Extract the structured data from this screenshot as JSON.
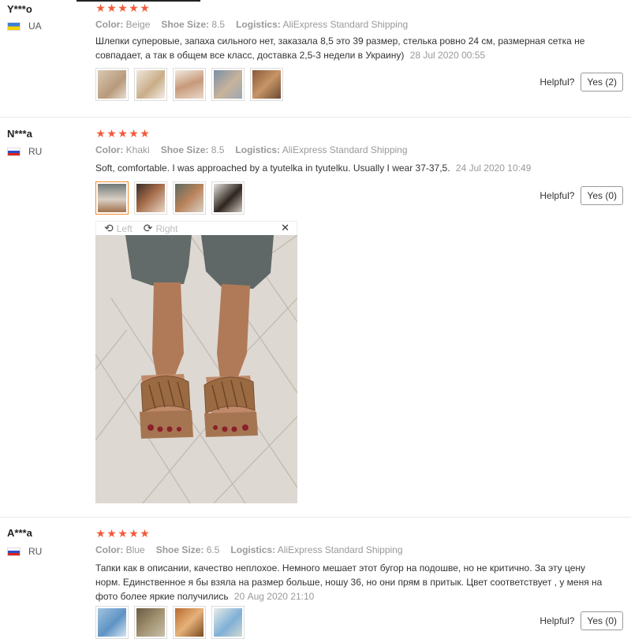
{
  "reviews": [
    {
      "user": "Y***o",
      "country": "UA",
      "flag": "ukraine-flag-icon",
      "stars": [
        "★",
        "★",
        "★",
        "★",
        "★"
      ],
      "color_label": "Color:",
      "color": "Beige",
      "size_label": "Shoe Size:",
      "size": "8.5",
      "logistics_label": "Logistics:",
      "logistics": "AliExpress Standard Shipping",
      "text": "Шлепки суперовые, запаха сильного нет, заказала 8,5 это 39 размер, стелька ровно 24 см, размерная сетка не совпадает, а так в общем все класс, доставка 2,5-3 недели в Украину)",
      "date": "28 Jul 2020 00:55",
      "helpful_label": "Helpful?",
      "yes_label": "Yes (2)"
    },
    {
      "user": "N***a",
      "country": "RU",
      "flag": "russia-flag-icon",
      "stars": [
        "★",
        "★",
        "★",
        "★",
        "★"
      ],
      "color_label": "Color:",
      "color": "Khaki",
      "size_label": "Shoe Size:",
      "size": "8.5",
      "logistics_label": "Logistics:",
      "logistics": "AliExpress Standard Shipping",
      "text": "Soft, comfortable. I was approached by a tyutelka in tyutelku. Usually I wear 37-37,5.",
      "date": "24 Jul 2020 10:49",
      "helpful_label": "Helpful?",
      "yes_label": "Yes (0)"
    },
    {
      "user": "A***a",
      "country": "RU",
      "flag": "russia-flag-icon",
      "stars": [
        "★",
        "★",
        "★",
        "★",
        "★"
      ],
      "color_label": "Color:",
      "color": "Blue",
      "size_label": "Shoe Size:",
      "size": "6.5",
      "logistics_label": "Logistics:",
      "logistics": "AliExpress Standard Shipping",
      "text": "Тапки как в описании, качество неплохое. Немного мешает этот бугор на подошве, но не критично. За эту цену норм. Единственное я бы взяла на размер больше, ношу 36, но они прям в притык. Цвет соответствует , у меня на фото более яркие получились",
      "date": "20 Aug 2020 21:10",
      "helpful_label": "Helpful?",
      "yes_label": "Yes (0)"
    }
  ],
  "viewer": {
    "left_label": "Left",
    "right_label": "Right",
    "close_icon": "close-icon",
    "rotate_left_icon": "rotate-left-icon",
    "rotate_right_icon": "rotate-right-icon"
  },
  "colors": {
    "star": "#f35a3a",
    "active_thumb_border": "#f08a2c"
  }
}
